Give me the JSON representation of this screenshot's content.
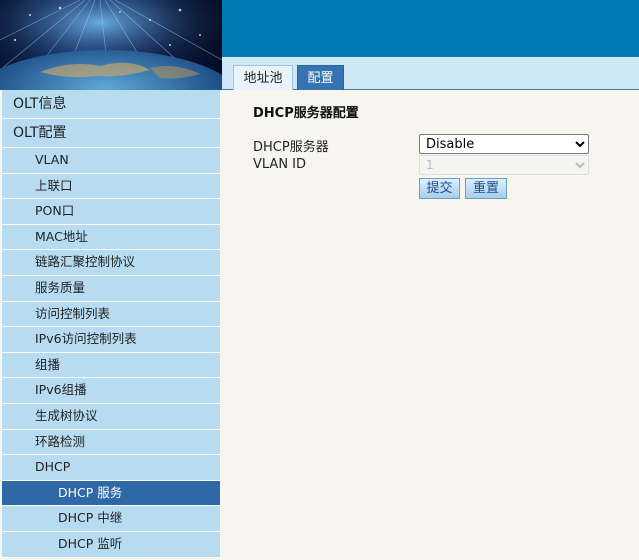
{
  "tabs": {
    "pool": "地址池",
    "config": "配置"
  },
  "sidebar": {
    "olt_info": "OLT信息",
    "olt_config": "OLT配置",
    "items": [
      "VLAN",
      "上联口",
      "PON口",
      "MAC地址",
      "链路汇聚控制协议",
      "服务质量",
      "访问控制列表",
      "IPv6访问控制列表",
      "组播",
      "IPv6组播",
      "生成树协议",
      "环路检测",
      "DHCP"
    ],
    "dhcp_sub": [
      "DHCP 服务",
      "DHCP 中继",
      "DHCP 监听"
    ],
    "active": "DHCP 服务"
  },
  "form": {
    "title": "DHCP服务器配置",
    "dhcp_server_label": "DHCP服务器",
    "dhcp_server_value": "Disable",
    "vlan_id_label": "VLAN ID",
    "vlan_id_value": "1",
    "submit": "提交",
    "reset": "重置"
  },
  "colors": {
    "header": "#007ab5",
    "nav_bg": "#b7dcf1",
    "nav_active": "#2f68a6",
    "page_bg": "#f6f6ee"
  },
  "icons": [
    "globe-fiber-optic-banner"
  ]
}
